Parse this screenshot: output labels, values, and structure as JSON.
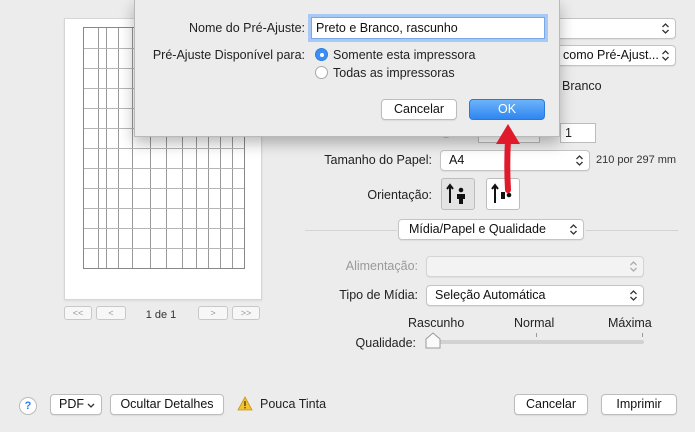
{
  "preset_dialog": {
    "name_label": "Nome do Pré-Ajuste:",
    "name_value": "Preto e Branco, rascunho",
    "available_label": "Pré-Ajuste Disponível para:",
    "option_this_printer": "Somente esta impressora",
    "option_all_printers": "Todas as impressoras",
    "cancel_label": "Cancelar",
    "ok_label": "OK"
  },
  "background_fragments": {
    "preset_popup_tail": "como Pré-Ajust...",
    "bw_tail": "Branco",
    "copies_value": "1"
  },
  "paper": {
    "size_label": "Tamanho do Papel:",
    "size_value": "A4",
    "size_dimensions": "210 por 297 mm",
    "orientation_label": "Orientação:"
  },
  "section_popup": "Mídia/Papel e Qualidade",
  "media": {
    "feed_label": "Alimentação:",
    "feed_value": "",
    "type_label": "Tipo de Mídia:",
    "type_value": "Seleção Automática",
    "quality_label": "Qualidade:",
    "quality_draft": "Rascunho",
    "quality_normal": "Normal",
    "quality_max": "Máxima",
    "quality_level": 0
  },
  "preview": {
    "page_indicator": "1 de 1",
    "nav_first": "<<",
    "nav_prev": "<",
    "nav_next": ">",
    "nav_last": ">>"
  },
  "footer": {
    "help": "?",
    "pdf_label": "PDF",
    "hide_details": "Ocultar Detalhes",
    "low_ink": "Pouca Tinta",
    "cancel": "Cancelar",
    "print": "Imprimir"
  },
  "colors": {
    "accent": "#3b8ef5",
    "arrow": "#e0192b"
  }
}
